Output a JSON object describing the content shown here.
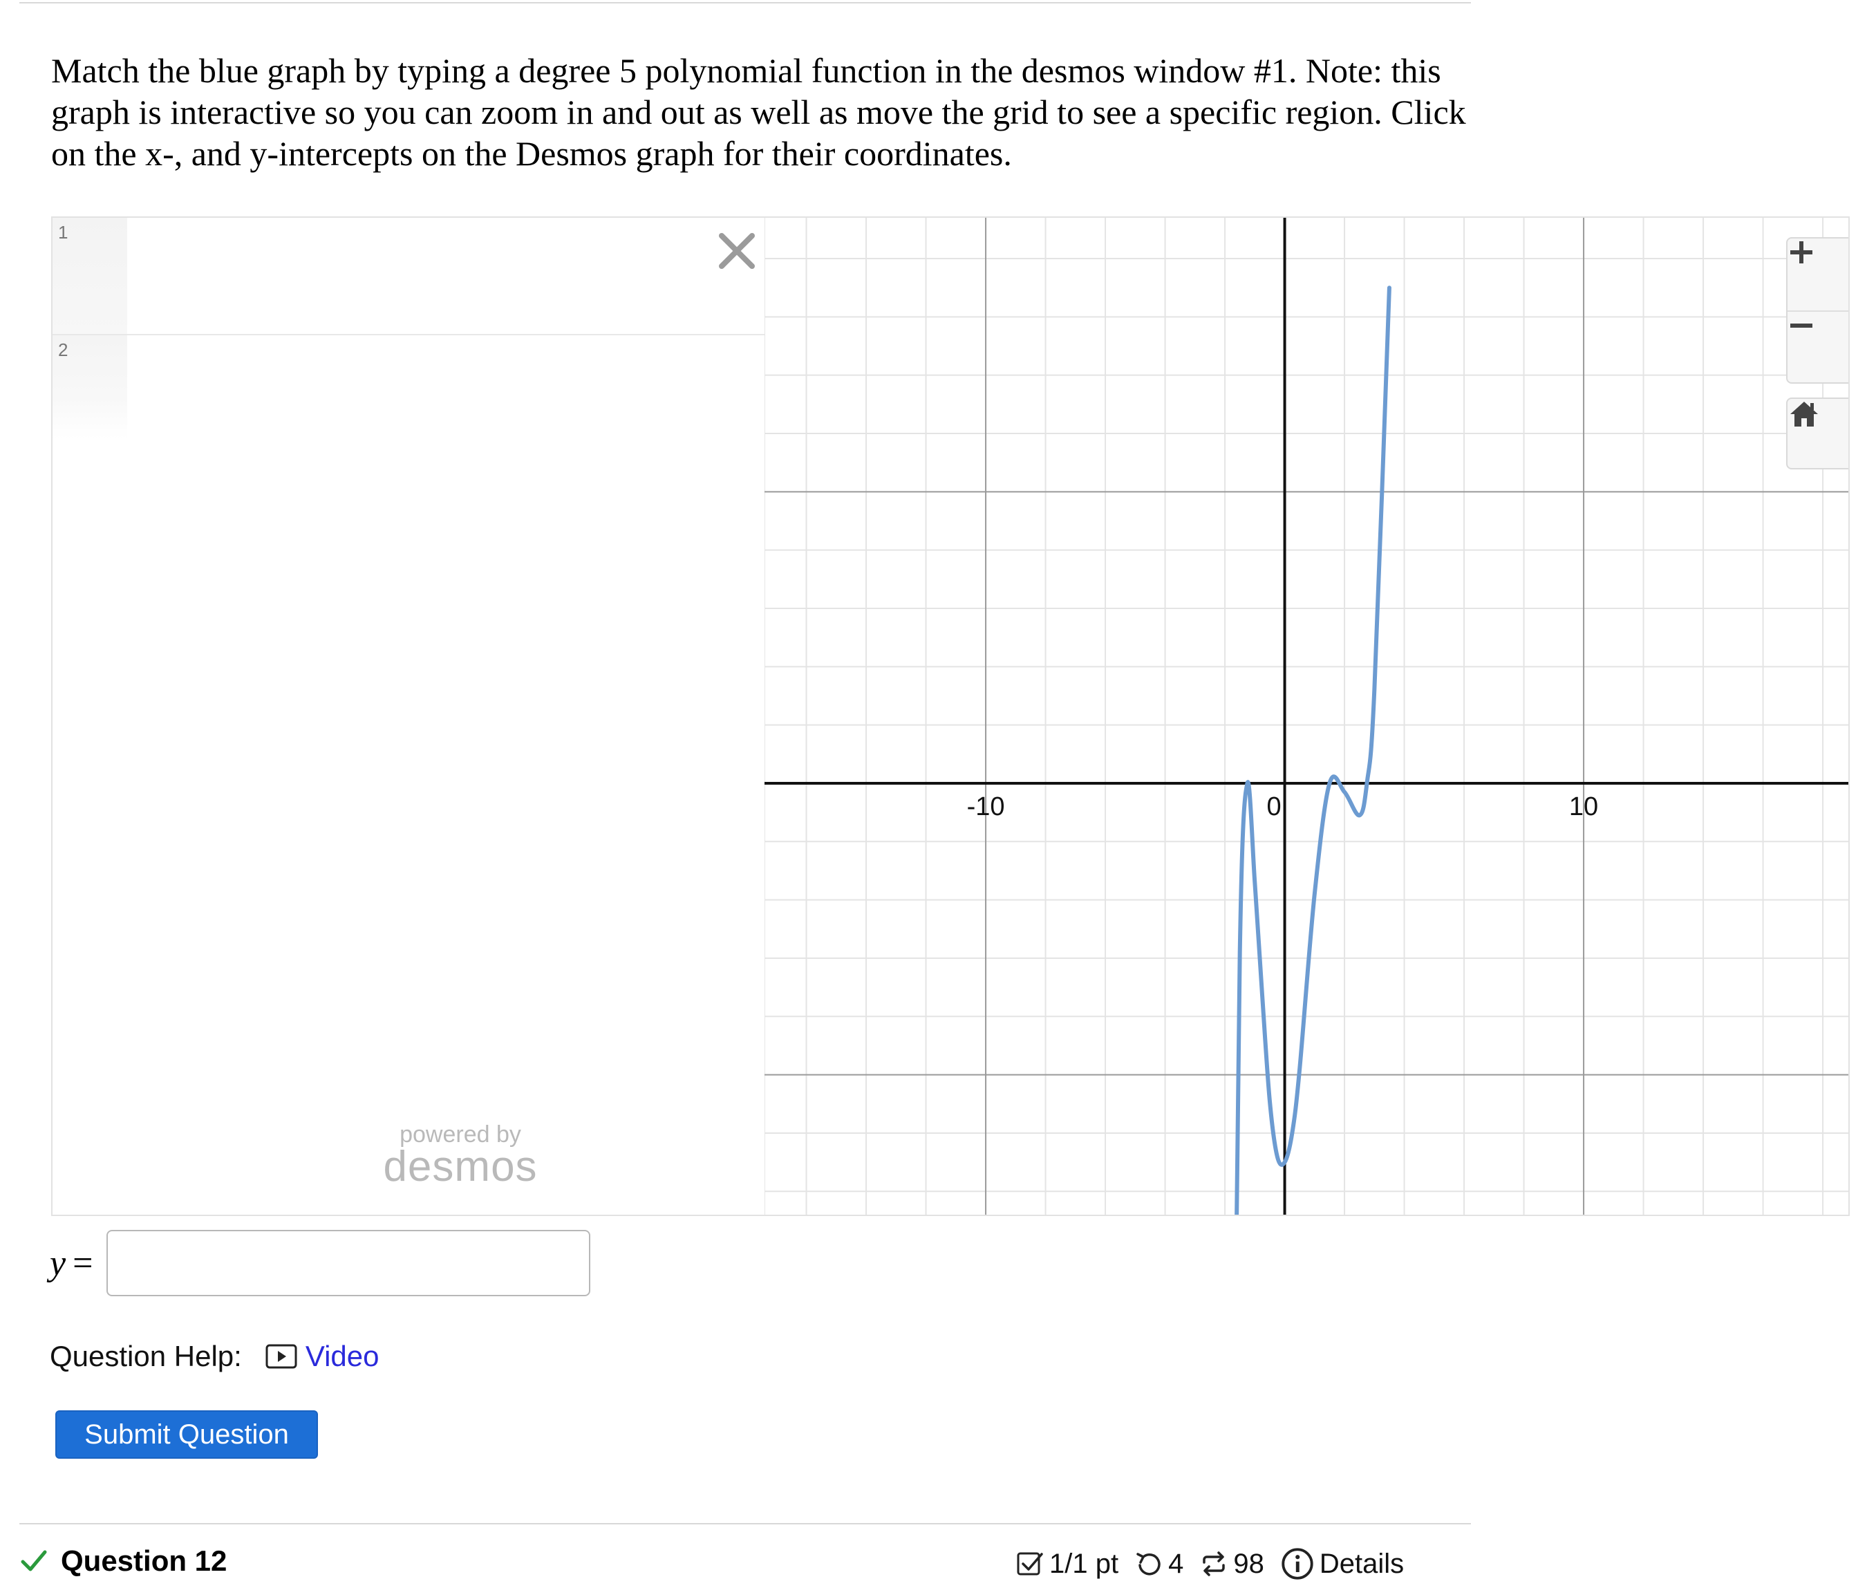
{
  "prompt": "Match the blue graph by typing a degree 5 polynomial function in the desmos window #1. Note: this graph is interactive so you can zoom in and out as well as move the grid to see a specific region. Click on the x-, and y-intercepts on the Desmos graph for their coordinates.",
  "desmos": {
    "rows": [
      {
        "num": "1"
      },
      {
        "num": "2"
      }
    ],
    "powered_by": "powered by",
    "logo": "desmos",
    "icons": {
      "close": "close-x-icon",
      "zoom_in": "plus-icon",
      "zoom_out": "minus-icon",
      "home": "home-icon"
    }
  },
  "chart_data": {
    "type": "line",
    "xlim": [
      -17.4,
      18.9
    ],
    "ylim": [
      -14.8,
      19.4
    ],
    "grid": true,
    "x_ticks": [
      "-10",
      "0",
      "10"
    ],
    "y_ticks": [
      "20",
      "-20"
    ],
    "series": [
      {
        "color": "#6c9bd1",
        "x": [
          -1.75,
          -1.5,
          -1.25,
          -1,
          -0.75,
          -0.5,
          -0.25,
          0,
          0.25,
          0.5,
          1,
          1.5,
          2,
          2.5,
          2.75,
          3,
          3.5
        ],
        "y": [
          -29.4,
          -5.8,
          0.0,
          -3.4,
          -7.3,
          -10.9,
          -12.8,
          -13.0,
          -12.0,
          -9.8,
          -3.8,
          0.0,
          -0.3,
          -1.1,
          0.0,
          3.2,
          17.0
        ]
      }
    ]
  },
  "answer": {
    "label_var": "y",
    "label_eq": "=",
    "value": ""
  },
  "help": {
    "label": "Question Help:",
    "video": "Video"
  },
  "submit_label": "Submit Question",
  "footer": {
    "question_title": "Question 12",
    "points": "1/1 pt",
    "retries": "4",
    "attempts": "98",
    "details": "Details"
  }
}
